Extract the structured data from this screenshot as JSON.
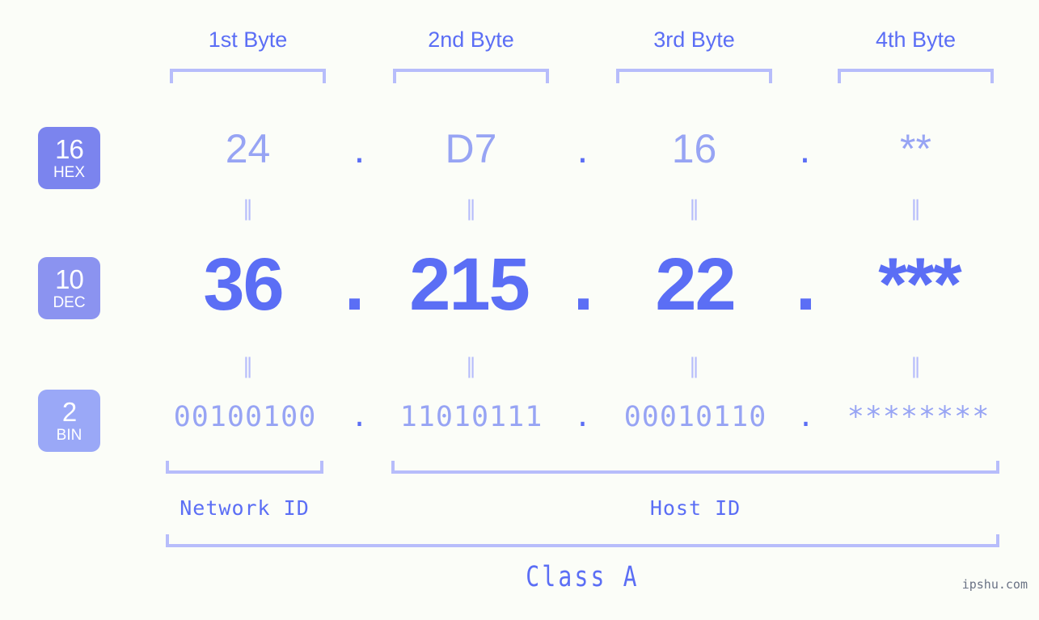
{
  "page": {
    "background": "#fbfdf8",
    "accent": "#5b6ef5",
    "accent_light": "#97a4f4",
    "bracket_color": "#b7bdfb",
    "watermark": "ipshu.com"
  },
  "byte_headers": [
    {
      "label": "1st Byte"
    },
    {
      "label": "2nd Byte"
    },
    {
      "label": "3rd Byte"
    },
    {
      "label": "4th Byte"
    }
  ],
  "radix_badges": [
    {
      "number": "16",
      "name": "HEX",
      "color": "#7b84ee"
    },
    {
      "number": "10",
      "name": "DEC",
      "color": "#8b93f0"
    },
    {
      "number": "2",
      "name": "BIN",
      "color": "#9aa8f7"
    }
  ],
  "rows": {
    "hex": {
      "radix": "16",
      "values": [
        "24",
        "D7",
        "16",
        "**"
      ],
      "separator": "."
    },
    "dec": {
      "radix": "10",
      "values": [
        "36",
        "215",
        "22",
        "***"
      ],
      "separator": "."
    },
    "bin": {
      "radix": "2",
      "values": [
        "00100100",
        "11010111",
        "00010110",
        "********"
      ],
      "separator": "."
    }
  },
  "equality_marks": {
    "glyph": "‖",
    "rows": 2,
    "count_per_row": 4
  },
  "id_sections": [
    {
      "label": "Network ID"
    },
    {
      "label": "Host ID"
    }
  ],
  "class_section": {
    "label": "Class A"
  }
}
